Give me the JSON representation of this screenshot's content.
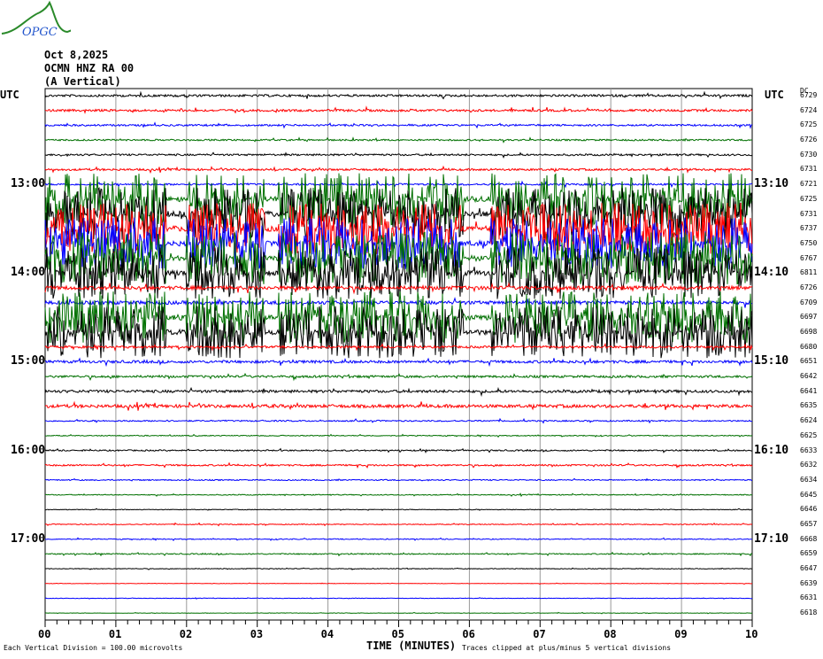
{
  "logo_text": "OPGC",
  "header": {
    "date": "Oct 8,2025",
    "station": "OCMN HNZ RA 00",
    "component": "(A Vertical)"
  },
  "left_tz": "UTC",
  "right_tz": "UTC",
  "dc_label": "DC",
  "footer": {
    "vertical_division": "Each Vertical Division =  100.00 microvolts",
    "xlabel": "TIME (MINUTES)",
    "clip_note": "Traces clipped at plus/minus 5 vertical divisions"
  },
  "chart_data": {
    "type": "line",
    "title": "OCMN HNZ RA 00 (A Vertical) Oct 8,2025",
    "xlabel": "TIME (MINUTES)",
    "xlim": [
      0,
      10
    ],
    "x_ticks": [
      "00",
      "01",
      "02",
      "03",
      "04",
      "05",
      "06",
      "07",
      "08",
      "09",
      "10"
    ],
    "left_hour_labels": [
      {
        "row": 6,
        "label": "13:00"
      },
      {
        "row": 12,
        "label": "14:00"
      },
      {
        "row": 18,
        "label": "15:00"
      },
      {
        "row": 24,
        "label": "16:00"
      },
      {
        "row": 30,
        "label": "17:00"
      }
    ],
    "right_hour_labels": [
      {
        "row": 6,
        "label": "13:10"
      },
      {
        "row": 12,
        "label": "14:10"
      },
      {
        "row": 18,
        "label": "15:10"
      },
      {
        "row": 24,
        "label": "16:10"
      },
      {
        "row": 30,
        "label": "17:10"
      }
    ],
    "trace_colors": [
      "#000000",
      "#ff0000",
      "#0000ff",
      "#007000"
    ],
    "dc_values": [
      "6729",
      "6724",
      "6725",
      "6726",
      "6730",
      "6731",
      "6721",
      "6725",
      "6731",
      "6737",
      "6750",
      "6767",
      "6811",
      "6726",
      "6709",
      "6697",
      "6698",
      "6680",
      "6651",
      "6642",
      "6641",
      "6635",
      "6624",
      "6625",
      "6633",
      "6632",
      "6634",
      "6645",
      "6646",
      "6657",
      "6668",
      "6659",
      "6647",
      "6639",
      "6631",
      "6618"
    ],
    "noise_level": [
      0.5,
      0.5,
      0.4,
      0.35,
      0.4,
      0.45,
      0.4,
      3,
      3,
      3,
      3,
      3,
      3,
      0.8,
      0.8,
      3,
      3,
      0.5,
      0.6,
      0.5,
      0.6,
      0.7,
      0.3,
      0.2,
      0.3,
      0.35,
      0.25,
      0.2,
      0.15,
      0.2,
      0.2,
      0.25,
      0.15,
      0.1,
      0.1,
      0.1
    ],
    "saturated_intervals_min": [
      [
        0,
        1.7
      ],
      [
        2,
        3.1
      ],
      [
        3.3,
        5.9
      ],
      [
        6.3,
        10
      ]
    ],
    "clip_divisions": 5
  }
}
